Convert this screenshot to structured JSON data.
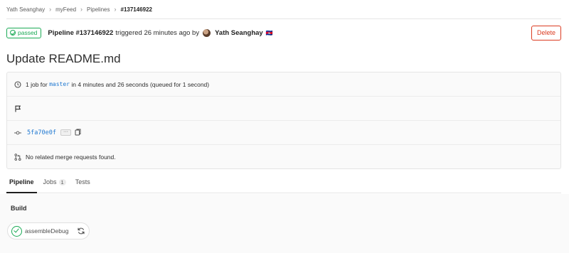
{
  "breadcrumb": {
    "items": [
      "Yath Seanghay",
      "myFeed",
      "Pipelines",
      "#137146922"
    ],
    "separator": "›"
  },
  "header": {
    "status": "passed",
    "pipeline_id": "Pipeline #137146922",
    "triggered_text": "triggered 26 minutes ago by",
    "author": "Yath Seanghay",
    "author_flag": "🇰🇭",
    "delete_label": "Delete"
  },
  "title": "Update README.md",
  "info": {
    "job_count_text": "1 job for",
    "branch": "master",
    "duration_text": "in 4 minutes and 26 seconds (queued for 1 second)",
    "commit_sha": "5fa70e0f",
    "ellipsis": "···",
    "merge_requests_text": "No related merge requests found."
  },
  "tabs": {
    "pipeline": "Pipeline",
    "jobs": "Jobs",
    "jobs_count": "1",
    "tests": "Tests"
  },
  "pipeline": {
    "stage": "Build",
    "job_name": "assembleDebug"
  },
  "colors": {
    "success": "#1aaa55",
    "danger": "#db3b21",
    "link": "#1f78d1"
  },
  "icons": {
    "status": "check-circle-icon",
    "clock": "clock-icon",
    "flag": "flag-icon",
    "commit": "commit-icon",
    "copy": "clipboard-icon",
    "merge_request": "merge-request-icon",
    "retry": "retry-icon"
  }
}
